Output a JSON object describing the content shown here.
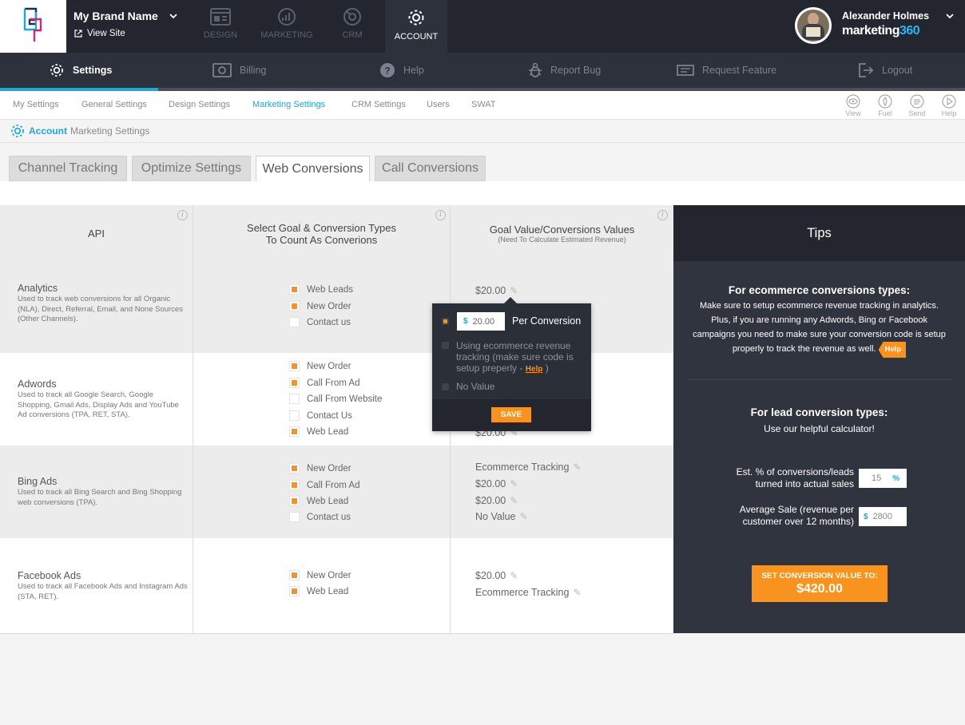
{
  "header": {
    "brand_name": "My Brand Name",
    "view_site": "View Site",
    "nav": [
      "DESIGN",
      "MARKETING",
      "CRM",
      "ACCOUNT"
    ],
    "user_name": "Alexander Holmes",
    "product_a": "marketing",
    "product_b": "360"
  },
  "secnav": [
    "Settings",
    "Billing",
    "Help",
    "Report Bug",
    "Request Feature",
    "Logout"
  ],
  "subnav": {
    "items": [
      "My Settings",
      "General Settings",
      "Design Settings",
      "Marketing Settings",
      "CRM Settings",
      "Users",
      "SWAT"
    ],
    "tools": [
      "View",
      "Fuel",
      "Send",
      "Help"
    ]
  },
  "breadcrumb": {
    "section": "Account",
    "page": "Marketing Settings"
  },
  "tabs": [
    "Channel Tracking",
    "Optimize Settings",
    "Web Conversions",
    "Call Conversions"
  ],
  "columns": {
    "api": "API",
    "goal_1": "Select Goal & Conversion Types",
    "goal_2": "To Count As Converions",
    "value_1": "Goal Value/Conversions Values",
    "value_2": "(Need To Calculate Estimated Revenue)"
  },
  "rows": [
    {
      "title": "Analytics",
      "desc": "Used to track web conversions for all Organic (NLA), Direct, Referral, Email, and None Sources (Other Channels).",
      "goals": [
        {
          "label": "Web Leads",
          "checked": true
        },
        {
          "label": "New Order",
          "checked": true
        },
        {
          "label": "Contact us",
          "checked": false
        }
      ],
      "values": [
        "$20.00"
      ]
    },
    {
      "title": "Adwords",
      "desc": "Used to track all Google Search, Google Shopping, Gmail Ads, Display Ads and YouTube Ad conversions (TPA, RET, STA).",
      "goals": [
        {
          "label": "New Order",
          "checked": true
        },
        {
          "label": "Call From Ad",
          "checked": true
        },
        {
          "label": "Call From Website",
          "checked": false
        },
        {
          "label": "Contact Us",
          "checked": false
        },
        {
          "label": "Web Lead",
          "checked": true
        }
      ],
      "values": [
        "$20.00"
      ]
    },
    {
      "title": "Bing Ads",
      "desc": "Used to track all Bing Search and Bing Shopping web conversions (TPA).",
      "goals": [
        {
          "label": "New Order",
          "checked": true
        },
        {
          "label": "Call From Ad",
          "checked": true
        },
        {
          "label": "Web Lead",
          "checked": true
        },
        {
          "label": "Contact us",
          "checked": false
        }
      ],
      "values": [
        "Ecommerce Tracking",
        "$20.00",
        "$20.00",
        "No Value"
      ]
    },
    {
      "title": "Facebook Ads",
      "desc": "Used to track all Facebook Ads and Instagram Ads (STA, RET).",
      "goals": [
        {
          "label": "New Order",
          "checked": true
        },
        {
          "label": "Web Lead",
          "checked": true
        }
      ],
      "values": [
        "$20.00",
        "Ecommerce Tracking"
      ]
    }
  ],
  "popover": {
    "currency": "$",
    "amount": "20.00",
    "per_conversion": "Per Conversion",
    "ecommerce_text": "Using ecommerce revenue tracking (make sure code is setup preperly -",
    "help": "Help",
    "close_paren": ")",
    "no_value": "No Value",
    "save": "SAVE"
  },
  "tips": {
    "title": "Tips",
    "ecom_heading": "For ecommerce conversions types:",
    "ecom_body": "Make sure to setup ecommerce revenue tracking in analytics. Plus, if you are running any Adwords, Bing or Facebook campaigns you need to make sure your conversion code is setup properly to track the revenue as well.",
    "help": "Help",
    "lead_heading": "For lead conversion types:",
    "lead_body": "Use our helpful calculator!",
    "pct_label": "Est. % of conversions/leads turned into actual sales",
    "pct_value": "15",
    "pct_suffix": "%",
    "sale_label": "Average Sale (revenue per customer over 12 months)",
    "sale_prefix": "$",
    "sale_value": "2800",
    "button_line1": "SET CONVERSION VALUE TO:",
    "button_line2": "$420.00"
  },
  "colors": {
    "accent": "#1ea7d8",
    "orange": "#f7931e",
    "dark": "#23262f"
  }
}
